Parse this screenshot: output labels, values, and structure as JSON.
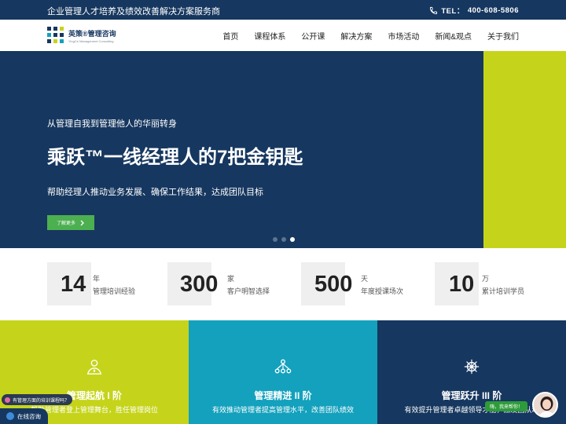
{
  "topbar": {
    "tagline": "企业管理人才培养及绩效改善解决方案服务商",
    "phone_label": "TEL：",
    "phone_number": "400-608-5806",
    "phone_icon": "phone-icon"
  },
  "brand": {
    "name_cn": "英策®管理咨询",
    "name_en": "YingCe Management Consulting"
  },
  "nav": {
    "items": [
      "首页",
      "课程体系",
      "公开课",
      "解决方案",
      "市场活动",
      "新闻&观点",
      "关于我们"
    ]
  },
  "hero": {
    "kicker": "从管理自我到管理他人的华丽转身",
    "title": "乘跃™一线经理人的7把金钥匙",
    "description": "帮助经理人推动业务发展、确保工作结果，达成团队目标",
    "cta_label": "了解更多",
    "slide_count": 3,
    "active_slide": 3,
    "colors": {
      "primary": "#16375f",
      "accent": "#c5d41a",
      "cta": "#4caf50"
    }
  },
  "stats": [
    {
      "number": "14",
      "unit": "年",
      "label": "管理培训经验"
    },
    {
      "number": "300",
      "unit": "家",
      "label": "客户明智选择"
    },
    {
      "number": "500",
      "unit": "天",
      "label": "年度授课场次"
    },
    {
      "number": "10",
      "unit": "万",
      "label": "累计培训学员"
    }
  ],
  "panels": [
    {
      "icon": "user-badge-icon",
      "title": "管理起航 I 阶",
      "description": "帮助管理者登上管理舞台，胜任管理岗位",
      "color": "#c5d41a"
    },
    {
      "icon": "team-network-icon",
      "title": "管理精进 II 阶",
      "description": "有效推动管理者提高管理水平，改善团队绩效",
      "color": "#13a1bd"
    },
    {
      "icon": "ship-wheel-icon",
      "title": "管理跃升 III 阶",
      "description": "有效提升管理者卓越领导才能，激发团队动",
      "color": "#16375f"
    }
  ],
  "chat": {
    "prompt": "有管理方面的培训课程吗？",
    "button_label": "在线咨询",
    "assistant_greeting": "嗨，我来帮你！"
  }
}
